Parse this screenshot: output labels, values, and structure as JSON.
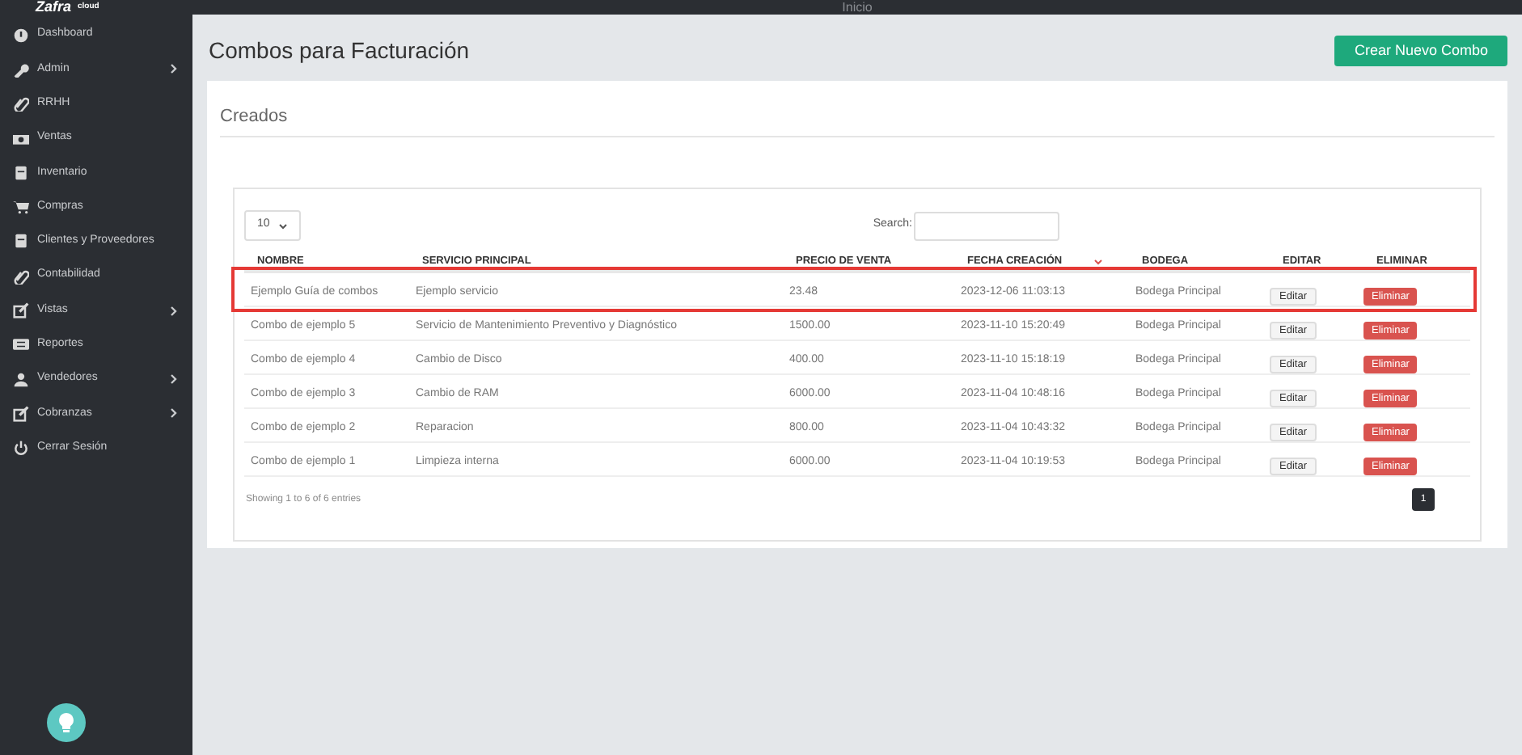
{
  "topbar": {
    "logo": "Zafra",
    "logo_suffix": "cloud",
    "title": "Inicio"
  },
  "sidebar": {
    "items": [
      {
        "label": "Dashboard",
        "has_submenu": false
      },
      {
        "label": "Admin",
        "has_submenu": true
      },
      {
        "label": "RRHH",
        "has_submenu": false
      },
      {
        "label": "Ventas",
        "has_submenu": false
      },
      {
        "label": "Inventario",
        "has_submenu": false
      },
      {
        "label": "Compras",
        "has_submenu": false
      },
      {
        "label": "Clientes y Proveedores",
        "has_submenu": false
      },
      {
        "label": "Contabilidad",
        "has_submenu": false
      },
      {
        "label": "Vistas",
        "has_submenu": true
      },
      {
        "label": "Reportes",
        "has_submenu": false
      },
      {
        "label": "Vendedores",
        "has_submenu": true
      },
      {
        "label": "Cobranzas",
        "has_submenu": true
      },
      {
        "label": "Cerrar Sesión",
        "has_submenu": false
      }
    ]
  },
  "page": {
    "title": "Combos para Facturación",
    "create_button": "Crear Nuevo Combo"
  },
  "card": {
    "title": "Creados",
    "length_select": {
      "value": "10"
    },
    "search": {
      "label": "Search:"
    },
    "table": {
      "columns": [
        {
          "label": "NOMBRE",
          "sorted": false
        },
        {
          "label": "SERVICIO PRINCIPAL",
          "sorted": false
        },
        {
          "label": "PRECIO DE VENTA",
          "sorted": false
        },
        {
          "label": "FECHA CREACIÓN",
          "sorted": true
        },
        {
          "label": "BODEGA",
          "sorted": false
        },
        {
          "label": "EDITAR",
          "sorted": false
        },
        {
          "label": "ELIMINAR",
          "sorted": false
        }
      ],
      "rows": [
        {
          "cells": [
            "Ejemplo Guía de combos",
            "Ejemplo servicio",
            "23.48",
            "2023-12-06 11:03:13",
            "Bodega Principal"
          ],
          "edit": "Editar",
          "delete": "Eliminar",
          "highlighted": true
        },
        {
          "cells": [
            "Combo de ejemplo 5",
            "Servicio de Mantenimiento Preventivo y Diagnóstico",
            "1500.00",
            "2023-11-10 15:20:49",
            "Bodega Principal"
          ],
          "edit": "Editar",
          "delete": "Eliminar",
          "highlighted": false
        },
        {
          "cells": [
            "Combo de ejemplo 4",
            "Cambio de Disco",
            "400.00",
            "2023-11-10 15:18:19",
            "Bodega Principal"
          ],
          "edit": "Editar",
          "delete": "Eliminar",
          "highlighted": false
        },
        {
          "cells": [
            "Combo de ejemplo 3",
            "Cambio de RAM",
            "6000.00",
            "2023-11-04 10:48:16",
            "Bodega Principal"
          ],
          "edit": "Editar",
          "delete": "Eliminar",
          "highlighted": false
        },
        {
          "cells": [
            "Combo de ejemplo 2",
            "Reparacion",
            "800.00",
            "2023-11-04 10:43:32",
            "Bodega Principal"
          ],
          "edit": "Editar",
          "delete": "Eliminar",
          "highlighted": false
        },
        {
          "cells": [
            "Combo de ejemplo 1",
            "Limpieza interna",
            "6000.00",
            "2023-11-04 10:19:53",
            "Bodega Principal"
          ],
          "edit": "Editar",
          "delete": "Eliminar",
          "highlighted": false
        }
      ]
    },
    "info": "Showing 1 to 6 of 6 entries",
    "pages": [
      {
        "label": "1",
        "selected": true
      }
    ]
  }
}
